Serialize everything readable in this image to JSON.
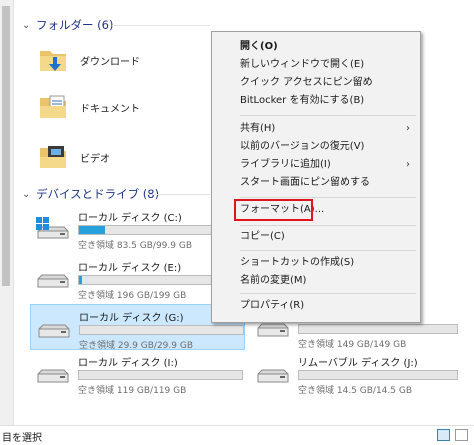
{
  "sections": {
    "folders": "フォルダー (6)",
    "devices": "デバイスとドライブ (8)"
  },
  "folders": [
    {
      "label": "ダウンロード",
      "icon": "downloads-folder-icon"
    },
    {
      "label": "ドキュメント",
      "icon": "documents-folder-icon"
    },
    {
      "label": "ビデオ",
      "icon": "videos-folder-icon"
    }
  ],
  "drives": [
    {
      "name": "ローカル ディスク (C:)",
      "free": "空き領域 83.5 GB/99.9 GB",
      "used_fraction": 0.16,
      "icon": "windows-drive-icon"
    },
    {
      "name": "ローカル ディスク (E:)",
      "free": "空き領域 196 GB/199 GB",
      "used_fraction": 0.02,
      "icon": "hard-drive-icon"
    },
    {
      "name": "ローカル ディスク (G:)",
      "free": "空き領域 29.9 GB/29.9 GB",
      "used_fraction": 0.0,
      "icon": "hard-drive-icon",
      "selected": true
    },
    {
      "name": "",
      "free": "空き領域 149 GB/149 GB",
      "used_fraction": 0.0,
      "icon": "hard-drive-icon"
    },
    {
      "name": "ローカル ディスク (I:)",
      "free": "空き領域 119 GB/119 GB",
      "used_fraction": 0.0,
      "icon": "hard-drive-icon"
    },
    {
      "name": "リムーバブル ディスク (J:)",
      "free": "空き領域 14.5 GB/14.5 GB",
      "used_fraction": 0.0,
      "icon": "removable-drive-icon"
    }
  ],
  "context_menu": {
    "open": "開く(O)",
    "open_new_window": "新しいウィンドウで開く(E)",
    "pin_quick_access": "クイック アクセスにピン留め",
    "bitlocker": "BitLocker を有効にする(B)",
    "share": "共有(H)",
    "restore_previous": "以前のバージョンの復元(V)",
    "add_to_library": "ライブラリに追加(I)",
    "pin_start": "スタート画面にピン留めする",
    "format": "フォーマット(A)...",
    "copy": "コピー(C)",
    "create_shortcut": "ショートカットの作成(S)",
    "rename": "名前の変更(M)",
    "properties": "プロパティ(R)",
    "highlight_color": "#e0141c"
  },
  "status": {
    "text": "目を選択"
  },
  "colors": {
    "accent": "#26a0da",
    "section_text": "#1e3287",
    "selection": "#cce8ff"
  }
}
